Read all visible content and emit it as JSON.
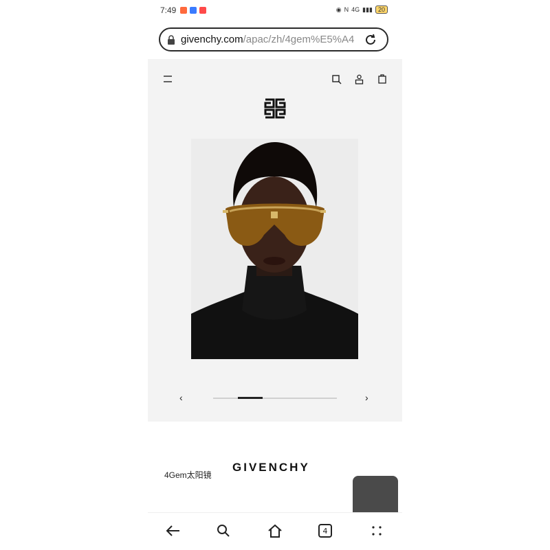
{
  "status_bar": {
    "time": "7:49",
    "network": "4G",
    "battery": "20",
    "app_icon_colors": [
      "#ff6a3d",
      "#3a7bff",
      "#ff4a4a"
    ]
  },
  "browser": {
    "url_host": "givenchy.com",
    "url_path": "/apac/zh/4gem%E5%A4"
  },
  "page": {
    "carousel": {
      "active_index": 1,
      "total": 5
    },
    "product_name": "4Gem太阳镜",
    "brand_wordmark": "GIVENCHY"
  },
  "nav": {
    "tab_count": "4"
  },
  "colors": {
    "accent": "#111111",
    "page_bg": "#f3f3f3",
    "lens": "#8a5a14"
  },
  "icons": {
    "menu": "menu-icon",
    "search": "search-icon",
    "account": "account-icon",
    "bag": "shopping-bag-icon",
    "logo": "givenchy-4g-logo"
  }
}
